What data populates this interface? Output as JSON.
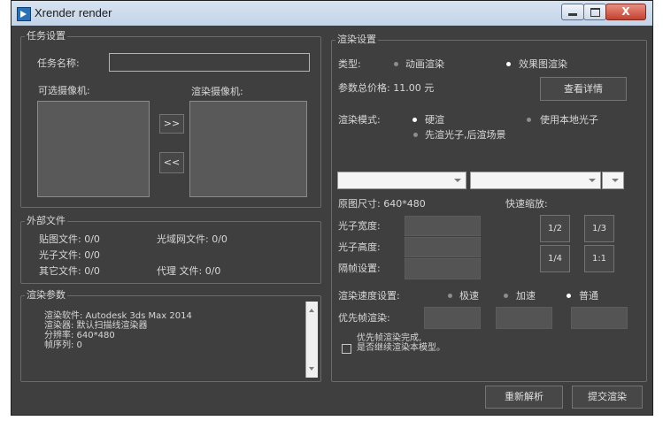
{
  "window": {
    "title": "Xrender render",
    "min": "",
    "max": "",
    "close": "X"
  },
  "task": {
    "group": "任务设置",
    "name_label": "任务名称:",
    "name_value": "",
    "available_label": "可选摄像机:",
    "render_label": "渲染摄像机:",
    "add_btn": ">>",
    "remove_btn": "<<"
  },
  "external": {
    "group": "外部文件",
    "map": "贴图文件: 0/0",
    "ies": "光域网文件: 0/0",
    "photon": "光子文件: 0/0",
    "other": "其它文件: 0/0",
    "proxy": "代理  文件: 0/0"
  },
  "params": {
    "group": "渲染参数",
    "lines": [
      "渲染软件: Autodesk 3ds Max 2014",
      "渲染器: 默认扫描线渲染器",
      "分辨率: 640*480",
      "帧序列: 0"
    ]
  },
  "render": {
    "group": "渲染设置",
    "type_label": "类型:",
    "type_anim": "动画渲染",
    "type_still": "效果图渲染",
    "price": "参数总价格: 11.00 元",
    "detail_btn": "查看详情",
    "mode_label": "渲染模式:",
    "mode_hard": "硬渲",
    "mode_local": "使用本地光子",
    "mode_photon_first": "先渲光子,后渲场景",
    "orig_size": "原图尺寸: 640*480",
    "quick_scale": "快速缩放:",
    "photon_w": "光子宽度:",
    "photon_h": "光子高度:",
    "frame_gap": "隔帧设置:",
    "scale_half": "1/2",
    "scale_third": "1/3",
    "scale_quarter": "1/4",
    "scale_full": "1:1",
    "speed_label": "渲染速度设置:",
    "speed_fast": "极速",
    "speed_accel": "加速",
    "speed_normal": "普通",
    "priority_label": "优先帧渲染:",
    "continue_line1": "优先帧渲染完成,",
    "continue_line2": "是否继续渲染本模型。"
  },
  "footer": {
    "reparse_btn": "重新解析",
    "submit_btn": "提交渲染"
  }
}
